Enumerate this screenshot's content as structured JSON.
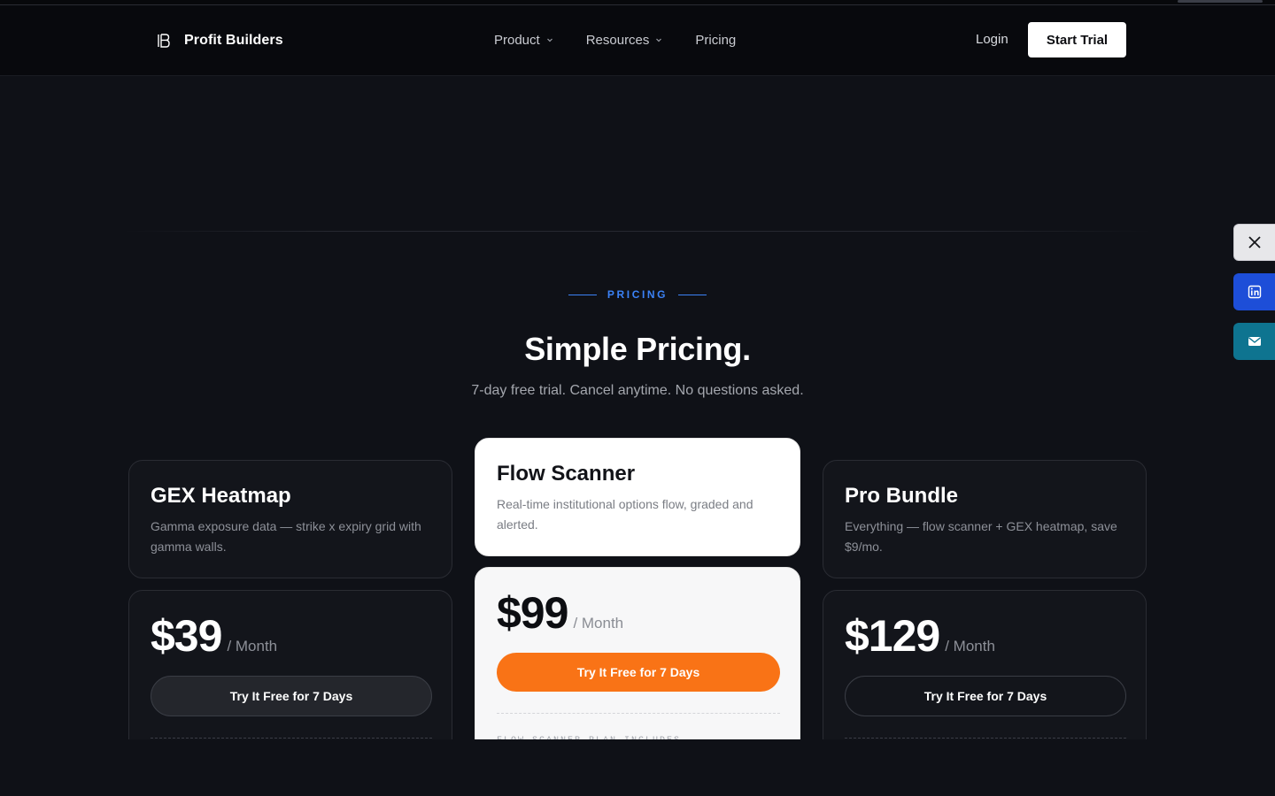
{
  "brand": {
    "name": "Profit Builders",
    "icon": "brand-logo-icon"
  },
  "nav": {
    "items": [
      {
        "label": "Product",
        "has_dropdown": true
      },
      {
        "label": "Resources",
        "has_dropdown": true
      },
      {
        "label": "Pricing",
        "has_dropdown": false
      }
    ],
    "login": "Login",
    "cta": "Start Trial"
  },
  "pricing": {
    "eyebrow": "PRICING",
    "title": "Simple Pricing.",
    "subtitle": "7-day free trial. Cancel anytime. No questions asked.",
    "plans": [
      {
        "name": "GEX Heatmap",
        "description": "Gamma exposure data — strike x expiry grid with gamma walls.",
        "price": "$39",
        "period": "/ Month",
        "cta": "Try It Free for 7 Days",
        "featured": false
      },
      {
        "name": "Flow Scanner",
        "description": "Real-time institutional options flow, graded and alerted.",
        "price": "$99",
        "period": "/ Month",
        "cta": "Try It Free for 7 Days",
        "featured": true,
        "includes_label": "FLOW SCANNER PLAN INCLUDES"
      },
      {
        "name": "Pro Bundle",
        "description": "Everything — flow scanner + GEX heatmap, save $9/mo.",
        "price": "$129",
        "period": "/ Month",
        "cta": "Try It Free for 7 Days",
        "featured": false
      }
    ]
  },
  "share": [
    {
      "icon": "x-icon",
      "color": "#e7e7ea"
    },
    {
      "icon": "linkedin-icon",
      "color": "#1d4ed8"
    },
    {
      "icon": "email-icon",
      "color": "#0e7490"
    }
  ],
  "colors": {
    "background": "#0f1117",
    "accent_blue": "#3b82f6",
    "accent_orange": "#f97316"
  }
}
